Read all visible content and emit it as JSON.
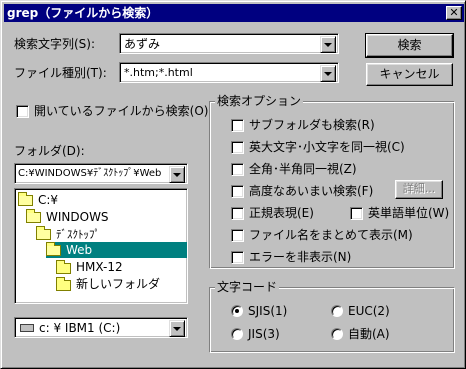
{
  "window": {
    "title": "grep（ファイルから検索）",
    "close": "✕"
  },
  "search": {
    "label": "検索文字列(S):",
    "value": "あずみ"
  },
  "filetype": {
    "label": "ファイル種別(T):",
    "value": "*.htm;*.html"
  },
  "buttons": {
    "search": "検索",
    "cancel": "キャンセル",
    "detail": "詳細..."
  },
  "open_files": {
    "label": "開いているファイルから検索(O)"
  },
  "folder": {
    "label": "フォルダ(D):",
    "value": "C:¥WINDOWS¥ﾃﾞｽｸﾄｯﾌﾟ¥Web",
    "tree": [
      "C:¥",
      "WINDOWS",
      "ﾃﾞｽｸﾄｯﾌﾟ",
      "Web",
      "HMX-12",
      "新しいフォルダ"
    ],
    "drive": "c: ¥ IBM1 (C:)"
  },
  "options": {
    "title": "検索オプション",
    "items": [
      "サブフォルダも検索(R)",
      "英大文字･小文字を同一視(C)",
      "全角･半角同一視(Z)",
      "高度なあいまい検索(F)",
      "正規表現(E)",
      "英単語単位(W)",
      "ファイル名をまとめて表示(M)",
      "エラーを非表示(N)"
    ]
  },
  "encoding": {
    "title": "文字コード",
    "items": [
      "SJIS(1)",
      "EUC(2)",
      "JIS(3)",
      "自動(A)"
    ],
    "selected": "SJIS(1)"
  }
}
